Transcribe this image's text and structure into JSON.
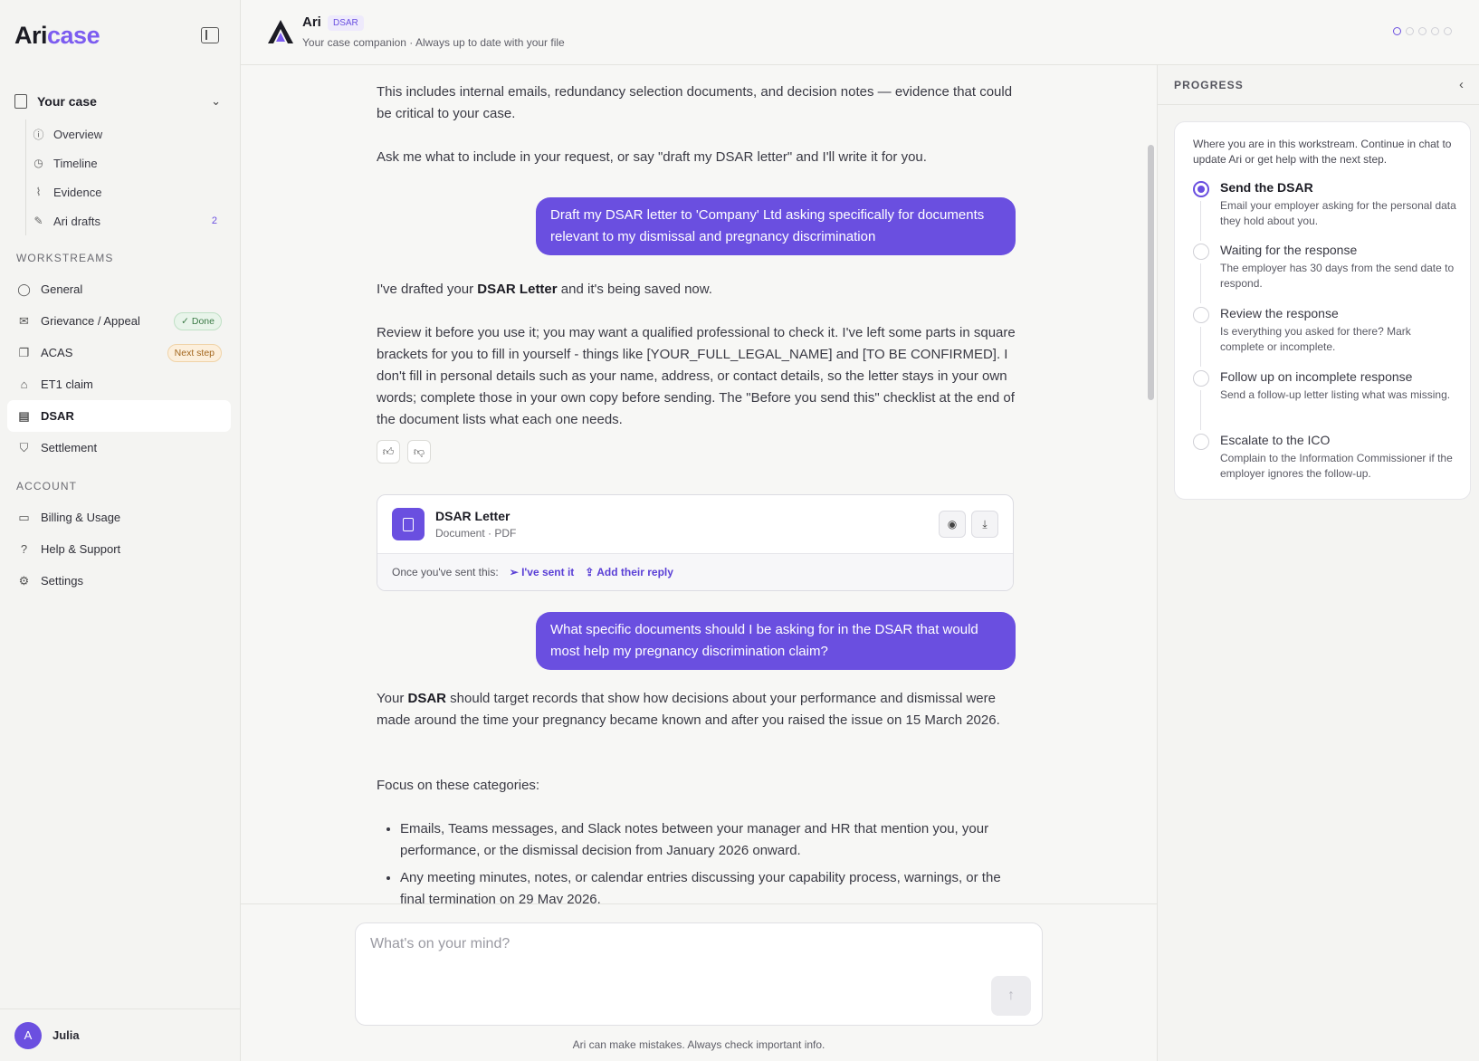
{
  "sidebar": {
    "logo_main": "Ari",
    "logo_accent": "case",
    "case_label": "Your case",
    "case_items": [
      {
        "label": "Overview",
        "icon": "info-circle-icon"
      },
      {
        "label": "Timeline",
        "icon": "clock-icon"
      },
      {
        "label": "Evidence",
        "icon": "paperclip-icon"
      },
      {
        "label": "Ari drafts",
        "icon": "pencil-icon",
        "count": "2"
      }
    ],
    "workstreams_label": "WORKSTREAMS",
    "workstreams": [
      {
        "label": "General",
        "icon": "chat-bubble-icon"
      },
      {
        "label": "Grievance / Appeal",
        "icon": "envelope-icon",
        "badge": "✓ Done"
      },
      {
        "label": "ACAS",
        "icon": "chat-double-icon",
        "badge": "Next step"
      },
      {
        "label": "ET1 claim",
        "icon": "bank-icon"
      },
      {
        "label": "DSAR",
        "icon": "document-icon",
        "active": true
      },
      {
        "label": "Settlement",
        "icon": "handshake-icon"
      }
    ],
    "account_label": "ACCOUNT",
    "account": [
      {
        "label": "Billing & Usage",
        "icon": "credit-card-icon"
      },
      {
        "label": "Help & Support",
        "icon": "question-circle-icon"
      },
      {
        "label": "Settings",
        "icon": "gear-icon"
      }
    ],
    "user": {
      "initial": "A",
      "name": "Julia"
    }
  },
  "header": {
    "name": "Ari",
    "tag": "DSAR",
    "subtitle": "Your case companion · Always up to date with your file"
  },
  "chat": {
    "m1": "This includes internal emails, redundancy selection documents, and decision notes — evidence that could be critical to your case.",
    "m2": "Ask me what to include in your request, or say \"draft my DSAR letter\" and I'll write it for you.",
    "u1": "Draft my DSAR letter to 'Company' Ltd asking specifically for documents relevant to my dismissal and pregnancy discrimination",
    "m3_pre": "I've drafted your ",
    "m3_bold": "DSAR Letter",
    "m3_post": " and it's being saved now.",
    "m4": "Review it before you use it; you may want a qualified professional to check it. I've left some parts in square brackets for you to fill in yourself - things like [YOUR_FULL_LEGAL_NAME] and [TO BE CONFIRMED]. I don't fill in personal details such as your name, address, or contact details, so the letter stays in your own words; complete those in your own copy before sending. The \"Before you send this\" checklist at the end of the document lists what each one needs.",
    "doc": {
      "title": "DSAR Letter",
      "meta": "Document · PDF",
      "once_sent": "Once you've sent this:",
      "sent_link": "I've sent it",
      "reply_link": "Add their reply"
    },
    "u2": "What specific documents should I be asking for in the DSAR that would most help my pregnancy discrimination claim?",
    "m5_pre": "Your ",
    "m5_bold": "DSAR",
    "m5_post": " should target records that show how decisions about your performance and dismissal were made around the time your pregnancy became known and after you raised the issue on 15 March 2026.",
    "m6": "Focus on these categories:",
    "bullets": [
      "Emails, Teams messages, and Slack notes between your manager and HR that mention you, your performance, or the dismissal decision from January 2026 onward.",
      "Any meeting minutes, notes, or calendar entries discussing your capability process, warnings, or the final termination on 29 May 2026."
    ]
  },
  "composer": {
    "placeholder": "What's on your mind?",
    "disclaimer": "Ari can make mistakes. Always check important info."
  },
  "progress": {
    "title": "PROGRESS",
    "intro": "Where you are in this workstream. Continue in chat to update Ari or get help with the next step.",
    "steps": [
      {
        "title": "Send the DSAR",
        "desc": "Email your employer asking for the personal data they hold about you.",
        "current": true
      },
      {
        "title": "Waiting for the response",
        "desc": "The employer has 30 days from the send date to respond."
      },
      {
        "title": "Review the response",
        "desc": "Is everything you asked for there? Mark complete or incomplete."
      },
      {
        "title": "Follow up on incomplete response",
        "desc": "Send a follow-up letter listing what was missing."
      },
      {
        "title": "Escalate to the ICO",
        "desc": "Complain to the Information Commissioner if the employer ignores the follow-up."
      }
    ]
  }
}
